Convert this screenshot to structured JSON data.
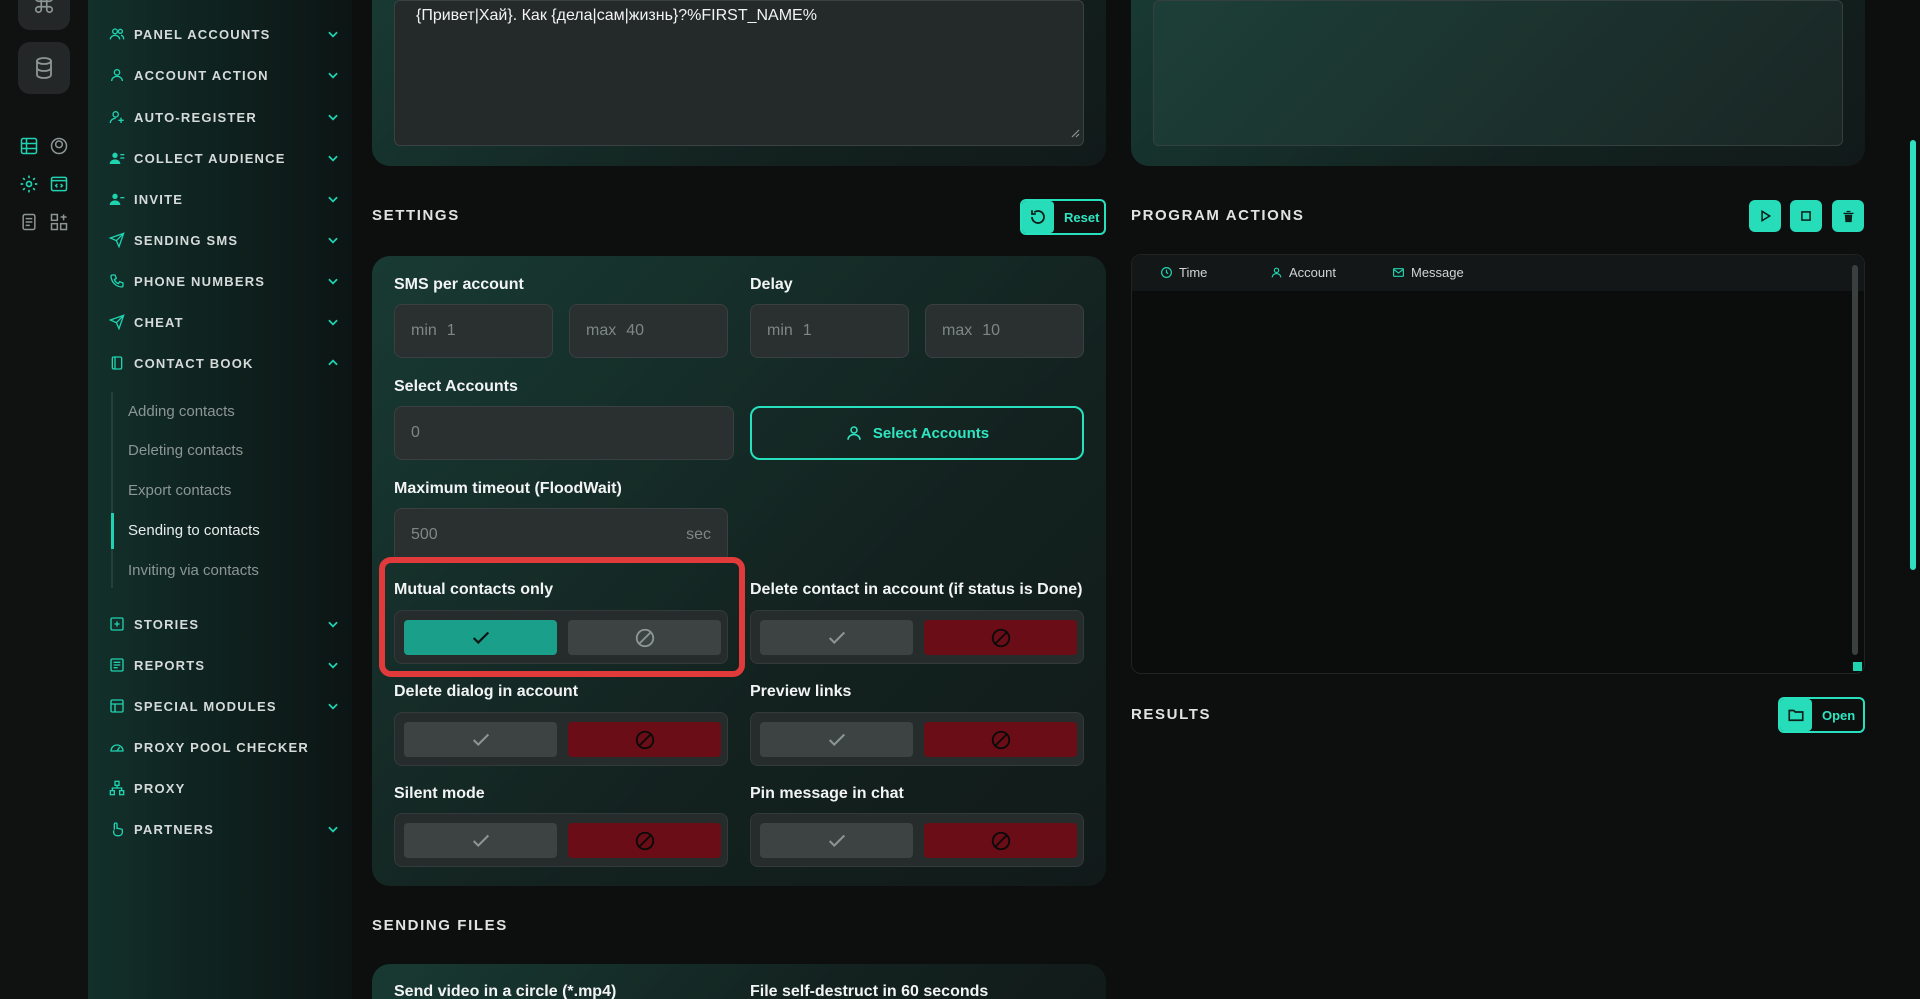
{
  "sidebar": {
    "items": [
      {
        "label": "PANEL ACCOUNTS"
      },
      {
        "label": "ACCOUNT ACTION"
      },
      {
        "label": "AUTO-REGISTER"
      },
      {
        "label": "COLLECT AUDIENCE"
      },
      {
        "label": "INVITE"
      },
      {
        "label": "SENDING SMS"
      },
      {
        "label": "PHONE NUMBERS"
      },
      {
        "label": "CHEAT"
      },
      {
        "label": "CONTACT BOOK"
      },
      {
        "label": "STORIES"
      },
      {
        "label": "REPORTS"
      },
      {
        "label": "SPECIAL MODULES"
      },
      {
        "label": "PROXY POOL CHECKER"
      },
      {
        "label": "PROXY"
      },
      {
        "label": "PARTNERS"
      }
    ],
    "contact_book_sub": [
      {
        "label": "Adding contacts"
      },
      {
        "label": "Deleting contacts"
      },
      {
        "label": "Export contacts"
      },
      {
        "label": "Sending to contacts"
      },
      {
        "label": "Inviting via contacts"
      }
    ]
  },
  "message": {
    "text": "{Привет|Хай}. Как {дела|сам|жизнь}?%FIRST_NAME%"
  },
  "settings": {
    "title": "SETTINGS",
    "reset_label": "Reset",
    "sms_per_account": {
      "label": "SMS per account",
      "min_prefix": "min",
      "min_value": "1",
      "max_prefix": "max",
      "max_value": "40"
    },
    "delay": {
      "label": "Delay",
      "min_prefix": "min",
      "min_value": "1",
      "max_prefix": "max",
      "max_value": "10"
    },
    "select_accounts": {
      "label": "Select Accounts",
      "value": "0",
      "button_label": "Select Accounts"
    },
    "timeout": {
      "label": "Maximum timeout (FloodWait)",
      "value": "500",
      "unit": "sec"
    },
    "toggles": {
      "mutual": {
        "label": "Mutual contacts only"
      },
      "delete_contact": {
        "label": "Delete contact in account (if status is Done)"
      },
      "delete_dialog": {
        "label": "Delete dialog in account"
      },
      "preview_links": {
        "label": "Preview links"
      },
      "silent": {
        "label": "Silent mode"
      },
      "pin": {
        "label": "Pin message in chat"
      }
    }
  },
  "program_actions": {
    "title": "PROGRAM ACTIONS",
    "columns": {
      "time": "Time",
      "account": "Account",
      "message": "Message"
    }
  },
  "results": {
    "title": "RESULTS",
    "open_label": "Open"
  },
  "sending_files": {
    "title": "SENDING FILES",
    "video_label": "Send video in a circle (*.mp4)",
    "self_destruct_label": "File self-destruct in 60 seconds"
  },
  "colors": {
    "accent": "#27dcb8",
    "danger": "#6a0d16",
    "highlight": "#e03a3a"
  }
}
